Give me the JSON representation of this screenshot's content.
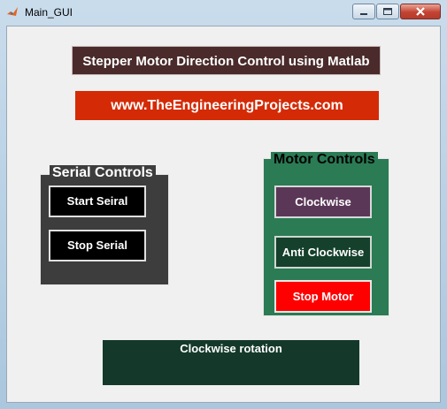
{
  "window": {
    "title": "Main_GUI"
  },
  "header": {
    "banner_title": "Stepper Motor Direction Control using Matlab",
    "banner_url": "www.TheEngineeringProjects.com"
  },
  "serial_controls": {
    "title": "Serial Controls",
    "start_label": "Start Seiral",
    "stop_label": "Stop Serial"
  },
  "motor_controls": {
    "title": "Motor Controls",
    "clockwise_label": "Clockwise",
    "anticlockwise_label": "Anti Clockwise",
    "stop_label": "Stop Motor"
  },
  "status": {
    "text": "Clockwise rotation"
  },
  "colors": {
    "banner_title_bg": "#4a2a2a",
    "banner_url_bg": "#d42a06",
    "serial_panel_bg": "#3d3d3d",
    "motor_panel_bg": "#2b7b55",
    "clockwise_bg": "#5a3757",
    "anticlockwise_bg": "#14402c",
    "stop_motor_bg": "#ff0000",
    "status_bg": "#14392a"
  },
  "icons": {
    "app": "matlab-icon",
    "minimize": "minimize-icon",
    "maximize": "maximize-icon",
    "close": "close-icon"
  }
}
